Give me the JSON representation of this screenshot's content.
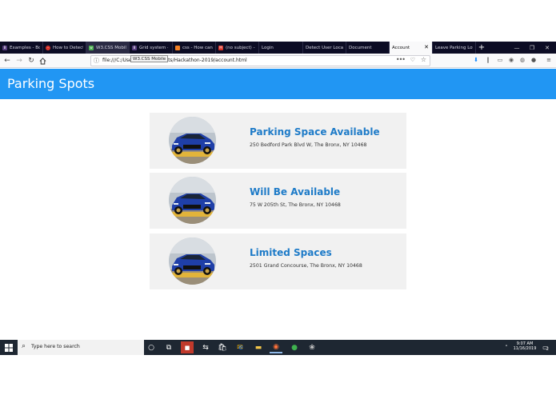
{
  "browser": {
    "tabs": [
      {
        "label": "Examples - Bo",
        "icon": "bootstrap-favicon",
        "color": "#563d7c"
      },
      {
        "label": "How to Detect",
        "icon": "no-entry-favicon",
        "color": "#d9342b"
      },
      {
        "label": "W3.CSS Mobile",
        "icon": "w3schools-favicon",
        "color": "#4caf50"
      },
      {
        "label": "Grid system · B",
        "icon": "bootstrap-favicon",
        "color": "#563d7c"
      },
      {
        "label": "css - How can",
        "icon": "stackoverflow-favicon",
        "color": "#f48024"
      },
      {
        "label": "(no subject) -",
        "icon": "gmail-favicon",
        "color": "#d93025"
      },
      {
        "label": "Login",
        "icon": "blank-favicon",
        "color": "#0c0c24"
      },
      {
        "label": "Detect User Locati",
        "icon": "blank-favicon",
        "color": "#0c0c24"
      },
      {
        "label": "Document",
        "icon": "blank-favicon",
        "color": "#0c0c24"
      },
      {
        "label": "Account",
        "icon": "blank-favicon",
        "color": "#f9f9fa",
        "active": true
      },
      {
        "label": "Leave Parking Lot",
        "icon": "blank-favicon",
        "color": "#0c0c24"
      }
    ],
    "new_tab": "+",
    "window_controls": [
      "—",
      "❐",
      "✕"
    ],
    "url": "file:///C:/Users/.../Documents/Hackathon-2019/account.html",
    "url_display": "file:///C:/Users",
    "url_suffix": "nts/Hackathon-2019/account.html",
    "tooltip": "W3.CSS Mobile",
    "page_actions": "•••"
  },
  "app": {
    "title": "Parking Spots",
    "accent": "#2196f3",
    "title_color": "#1e7bc8"
  },
  "spots": [
    {
      "title": "Parking Space Available",
      "address": "250 Bedford Park Blvd W, The Bronx, NY 10468"
    },
    {
      "title": "Will Be Available",
      "address": "75 W 205th St, The Bronx, NY 10468"
    },
    {
      "title": "Limited Spaces",
      "address": "2501 Grand Concourse, The Bronx, NY 10468"
    }
  ],
  "taskbar": {
    "search_placeholder": "Type here to search",
    "time": "9:07 AM",
    "date": "11/16/2019",
    "notification_count": "2"
  }
}
